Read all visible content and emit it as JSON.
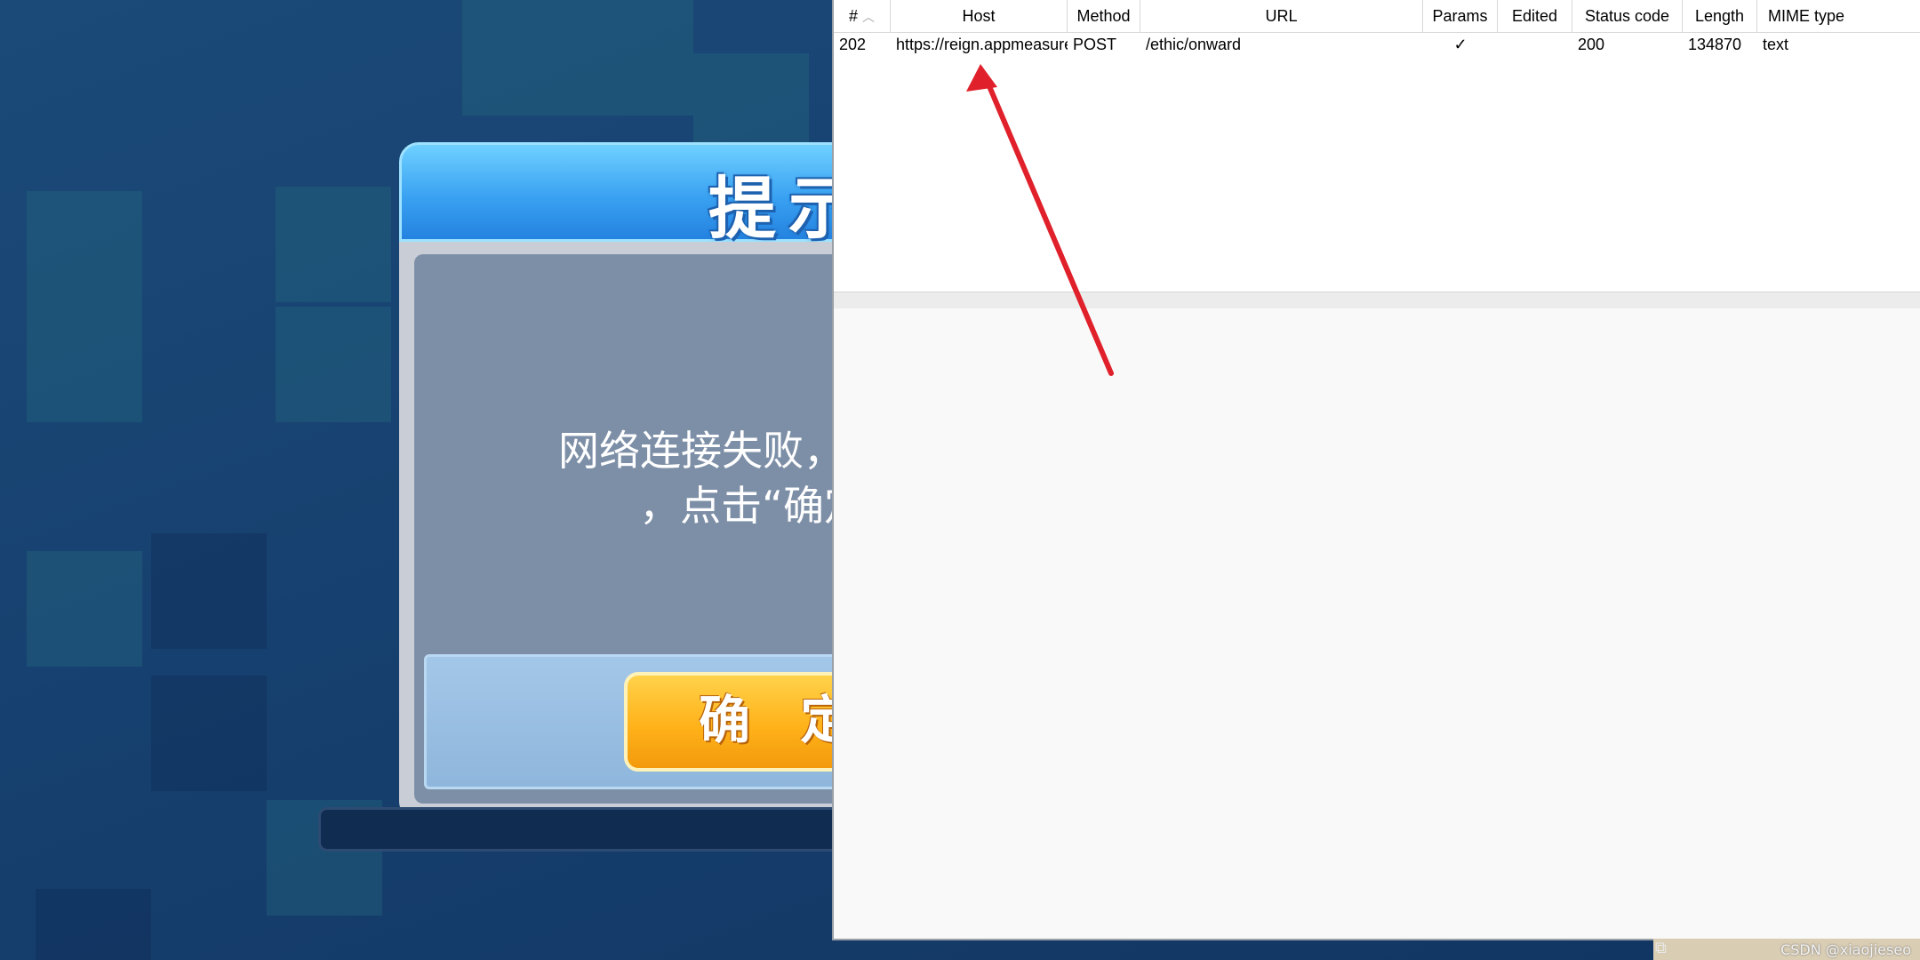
{
  "game_dialog": {
    "title": "提示",
    "message": "网络连接失败，请检查网络\n，点击“确定”重试",
    "confirm_label": "确 定"
  },
  "proxy_history": {
    "columns": [
      "#",
      "Host",
      "Method",
      "URL",
      "Params",
      "Edited",
      "Status code",
      "Length",
      "MIME type"
    ],
    "sort_column": "#",
    "rows": [
      {
        "index": "202",
        "host": "https://reign.appmeasuremen...",
        "method": "POST",
        "url": "/ethic/onward",
        "params": "✓",
        "edited": "",
        "status": "200",
        "length": "134870",
        "mime": "text"
      }
    ]
  },
  "watermark": "CSDN @xiaojieseo",
  "icons": {
    "sort": "chevron-up-icon",
    "taskbar": "window-icon",
    "arrow_color": "#e0202a"
  }
}
